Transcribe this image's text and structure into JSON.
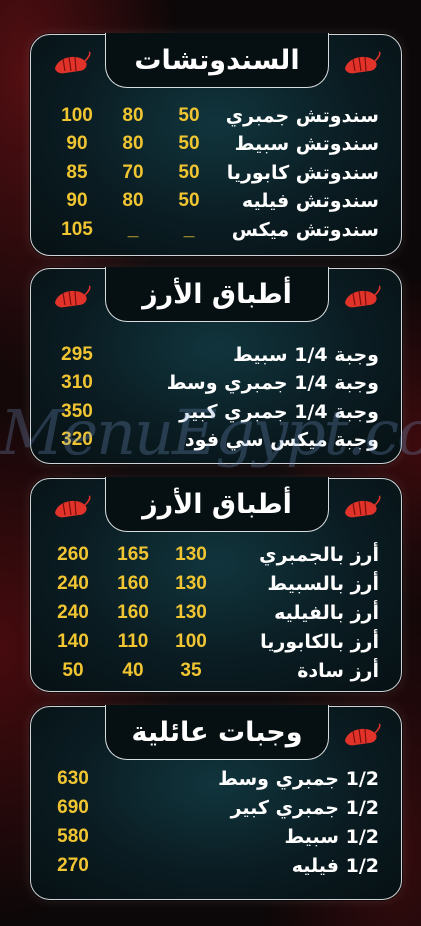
{
  "colors": {
    "price": "#f0c531",
    "text": "#ffffff",
    "panel": "#0a1c22",
    "border": "#cfd3d6"
  },
  "watermark": "MenuEgypt.com",
  "sections": [
    {
      "title": "السندوتشات",
      "rows": [
        {
          "name": "سندوتش جمبري",
          "prices": [
            "50",
            "80",
            "100"
          ]
        },
        {
          "name": "سندوتش سبيط",
          "prices": [
            "50",
            "80",
            "90"
          ]
        },
        {
          "name": "سندوتش كابوريا",
          "prices": [
            "50",
            "70",
            "85"
          ]
        },
        {
          "name": "سندوتش فيليه",
          "prices": [
            "50",
            "80",
            "90"
          ]
        },
        {
          "name": "سندوتش ميكس",
          "prices": [
            "_",
            "_",
            "105"
          ]
        }
      ]
    },
    {
      "title": "أطباق الأرز",
      "rows": [
        {
          "name": "وجبة 1/4 سبيط",
          "prices": [
            "295"
          ]
        },
        {
          "name": "وجبة 1/4 جمبري وسط",
          "prices": [
            "310"
          ]
        },
        {
          "name": "وجبة 1/4 جمبري كبير",
          "prices": [
            "350"
          ]
        },
        {
          "name": "وجبة ميكس سي فود",
          "prices": [
            "320"
          ]
        }
      ]
    },
    {
      "title": "أطباق الأرز",
      "rows": [
        {
          "name": "أرز بالجمبري",
          "prices": [
            "130",
            "165",
            "260"
          ]
        },
        {
          "name": "أرز بالسبيط",
          "prices": [
            "130",
            "160",
            "240"
          ]
        },
        {
          "name": "أرز بالفيليه",
          "prices": [
            "130",
            "160",
            "240"
          ]
        },
        {
          "name": "أرز بالكابوريا",
          "prices": [
            "100",
            "110",
            "140"
          ]
        },
        {
          "name": "أرز سادة",
          "prices": [
            "35",
            "40",
            "50"
          ]
        }
      ]
    },
    {
      "title": "وجبات عائلية",
      "rows": [
        {
          "name": "1/2 جمبري وسط",
          "prices": [
            "630"
          ]
        },
        {
          "name": "1/2 جمبري كبير",
          "prices": [
            "690"
          ]
        },
        {
          "name": "1/2 سبيط",
          "prices": [
            "580"
          ]
        },
        {
          "name": "1/2 فيليه",
          "prices": [
            "270"
          ]
        }
      ]
    }
  ]
}
